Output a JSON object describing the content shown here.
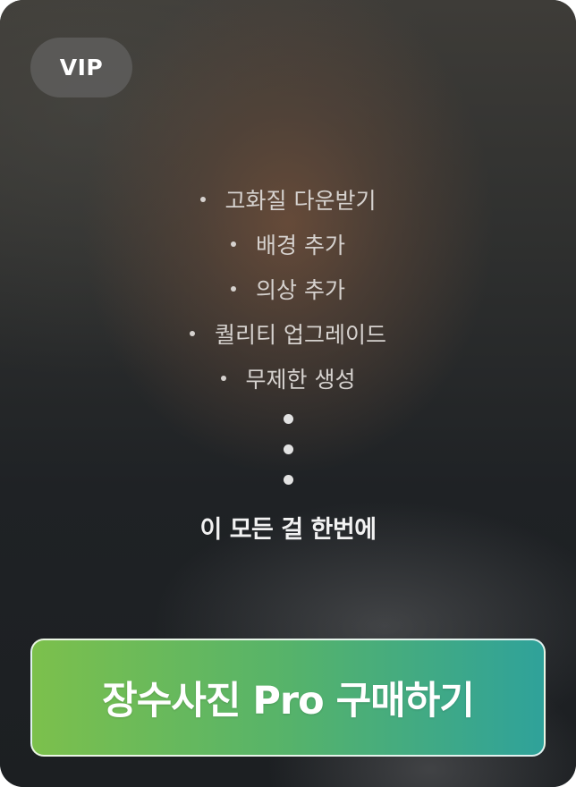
{
  "badge": {
    "label": "VIP"
  },
  "features": [
    "고화질 다운받기",
    "배경 추가",
    "의상 추가",
    "퀄리티 업그레이드",
    "무제한 생성"
  ],
  "tagline": "이 모든 걸 한번에",
  "cta": {
    "label": "장수사진 Pro 구매하기"
  },
  "colors": {
    "button_gradient_start": "#7cc04c",
    "button_gradient_end": "#2fa29a",
    "badge_bg": "#5a5a5a",
    "text_light": "#d6d2cf"
  }
}
